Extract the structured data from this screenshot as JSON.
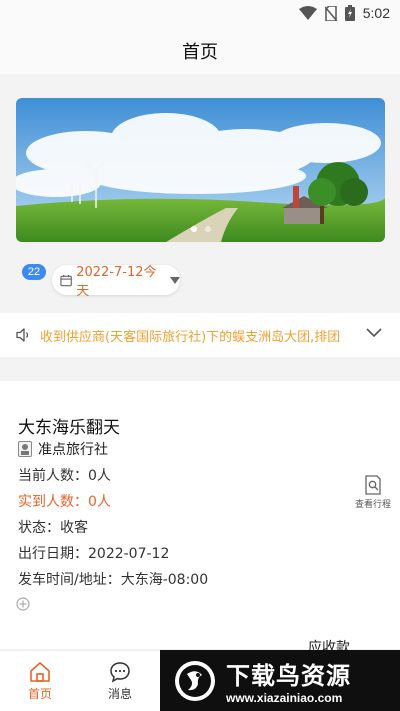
{
  "status_bar": {
    "time": "5:02"
  },
  "header": {
    "title": "首页"
  },
  "banner": {
    "slide_count": 2,
    "active_slide": 1
  },
  "date_filter": {
    "badge": "22",
    "date": "2022-7-12今天"
  },
  "notice": {
    "text": "收到供应商(天客国际旅行社)下的蜈支洲岛大团,排团"
  },
  "trip": {
    "title": "大东海乐翻天",
    "agency": "准点旅行社",
    "current_count": "当前人数：0人",
    "arrived_count": "实到人数：0人",
    "status": "状态：收客",
    "departure_date": "出行日期：2022-07-12",
    "departure_time_place": "发车时间/地址：大东海-08:00",
    "view_route_label": "查看行程",
    "amount_due_label": "应收款"
  },
  "tabbar": {
    "items": [
      {
        "label": "首页",
        "icon": "home-icon",
        "active": true
      },
      {
        "label": "消息",
        "icon": "message-icon",
        "active": false
      }
    ]
  },
  "watermark": {
    "title": "下载鸟资源",
    "url": "www.xiazainiao.com"
  },
  "colors": {
    "accent": "#e8632c",
    "notice": "#f0a030",
    "badge": "#3d8af7"
  }
}
